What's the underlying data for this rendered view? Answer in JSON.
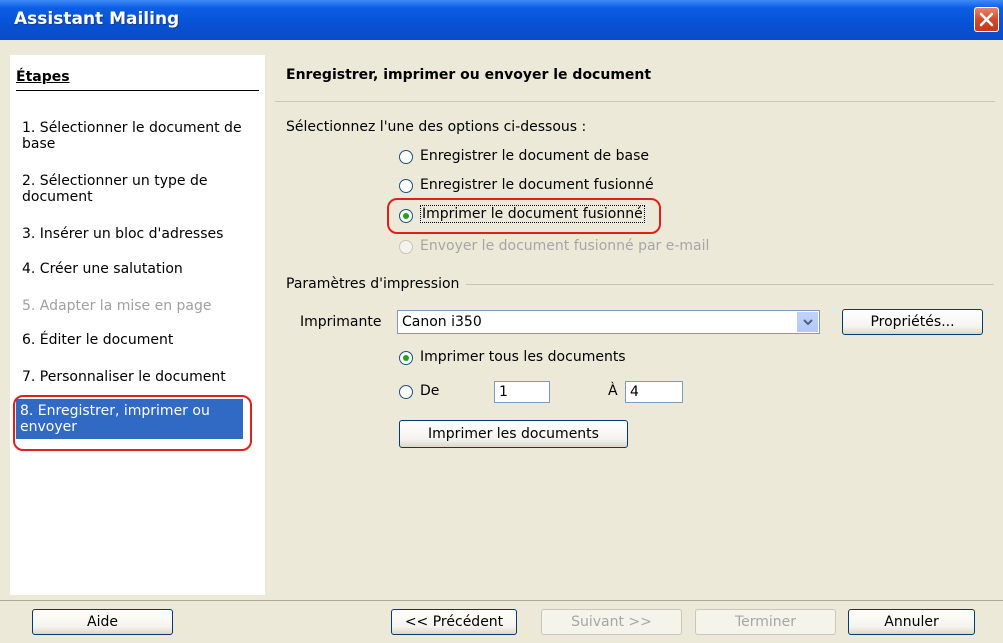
{
  "window": {
    "title": "Assistant Mailing",
    "close_icon": "close-icon"
  },
  "steps": {
    "title": "Étapes",
    "items": [
      {
        "label": "1.  Sélectionner le document de base",
        "state": "normal"
      },
      {
        "label": "2.  Sélectionner un type de document",
        "state": "normal"
      },
      {
        "label": "3.  Insérer un bloc d'adresses",
        "state": "normal"
      },
      {
        "label": "4.  Créer une salutation",
        "state": "normal"
      },
      {
        "label": "5.  Adapter la mise en page",
        "state": "disabled"
      },
      {
        "label": "6.  Éditer le document",
        "state": "normal"
      },
      {
        "label": "7.  Personnaliser le document",
        "state": "normal"
      },
      {
        "label": "8.  Enregistrer, imprimer ou envoyer",
        "state": "active"
      }
    ]
  },
  "main": {
    "title": "Enregistrer, imprimer ou envoyer le document",
    "options_prompt": "Sélectionnez l'une des options ci-dessous :",
    "options": [
      {
        "label": "Enregistrer le document de base",
        "checked": false,
        "disabled": false
      },
      {
        "label": "Enregistrer le document fusionné",
        "checked": false,
        "disabled": false
      },
      {
        "label": "Imprimer le document fusionné",
        "checked": true,
        "disabled": false
      },
      {
        "label": "Envoyer le document fusionné par e-mail",
        "checked": false,
        "disabled": true
      }
    ],
    "print_settings": {
      "section_label": "Paramètres d'impression",
      "printer_label": "Imprimante",
      "printer_value": "Canon i350",
      "properties_button": "Propriétés...",
      "print_all_label": "Imprimer tous les documents",
      "from_label": "De",
      "from_value": "1",
      "to_label": "À",
      "to_value": "4",
      "print_button": "Imprimer les documents"
    }
  },
  "footer": {
    "help": "Aide",
    "previous": "<< Précédent",
    "next": "Suivant >>",
    "finish": "Terminer",
    "cancel": "Annuler"
  },
  "colors": {
    "titlebar": "#0851d4",
    "selection": "#316ac5",
    "highlight_ring": "#e0201a",
    "radio_dot": "#21a121"
  }
}
